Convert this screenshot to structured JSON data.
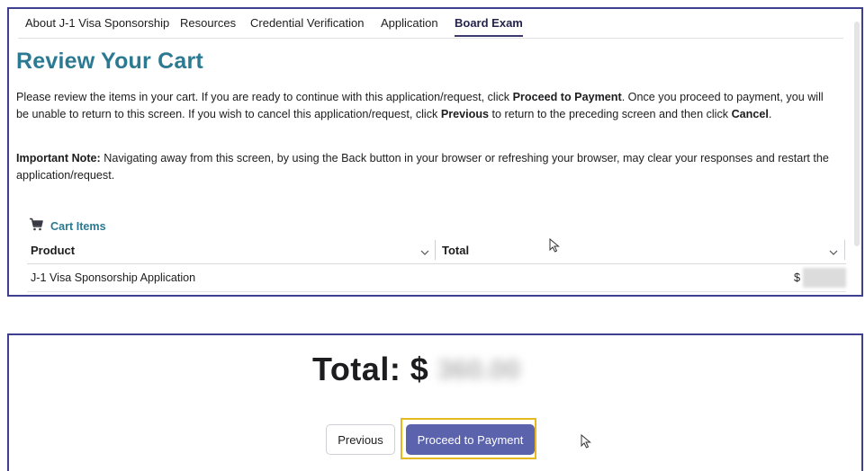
{
  "nav": {
    "items": [
      {
        "label": "About J-1 Visa Sponsorship",
        "active": false
      },
      {
        "label": "Resources",
        "active": false
      },
      {
        "label": "Credential Verification",
        "active": false
      },
      {
        "label": "Application",
        "active": false
      },
      {
        "label": "Board Exam",
        "active": true
      }
    ]
  },
  "page": {
    "title": "Review Your Cart"
  },
  "intro": {
    "t1": "Please review the items in your cart. If you are ready to continue with this application/request, click ",
    "b1": "Proceed to Payment",
    "t2": ". Once you proceed to payment, you will be unable to return to this screen. If you wish to cancel this application/request, click ",
    "b2": "Previous",
    "t3": " to return to the preceding screen and then click ",
    "b3": "Cancel",
    "t4": "."
  },
  "note": {
    "label": "Important Note:",
    "text": " Navigating away from this screen, by using the Back button in your browser or refreshing your browser, may clear your responses and restart the application/request."
  },
  "cart": {
    "title": "Cart Items",
    "icon": "cart-icon",
    "columns": [
      "Product",
      "Total"
    ],
    "rows": [
      {
        "product": "J-1 Visa Sponsorship Application",
        "total": "$"
      }
    ]
  },
  "summary": {
    "total_label": "Total: $",
    "total_value_blurred": "360.00"
  },
  "actions": {
    "previous_label": "Previous",
    "proceed_label": "Proceed to Payment"
  },
  "colors": {
    "title": "#2b7a91",
    "primary_button": "#5b63ad",
    "highlight": "#e8b820",
    "panel_border": "#3f3f8f"
  }
}
